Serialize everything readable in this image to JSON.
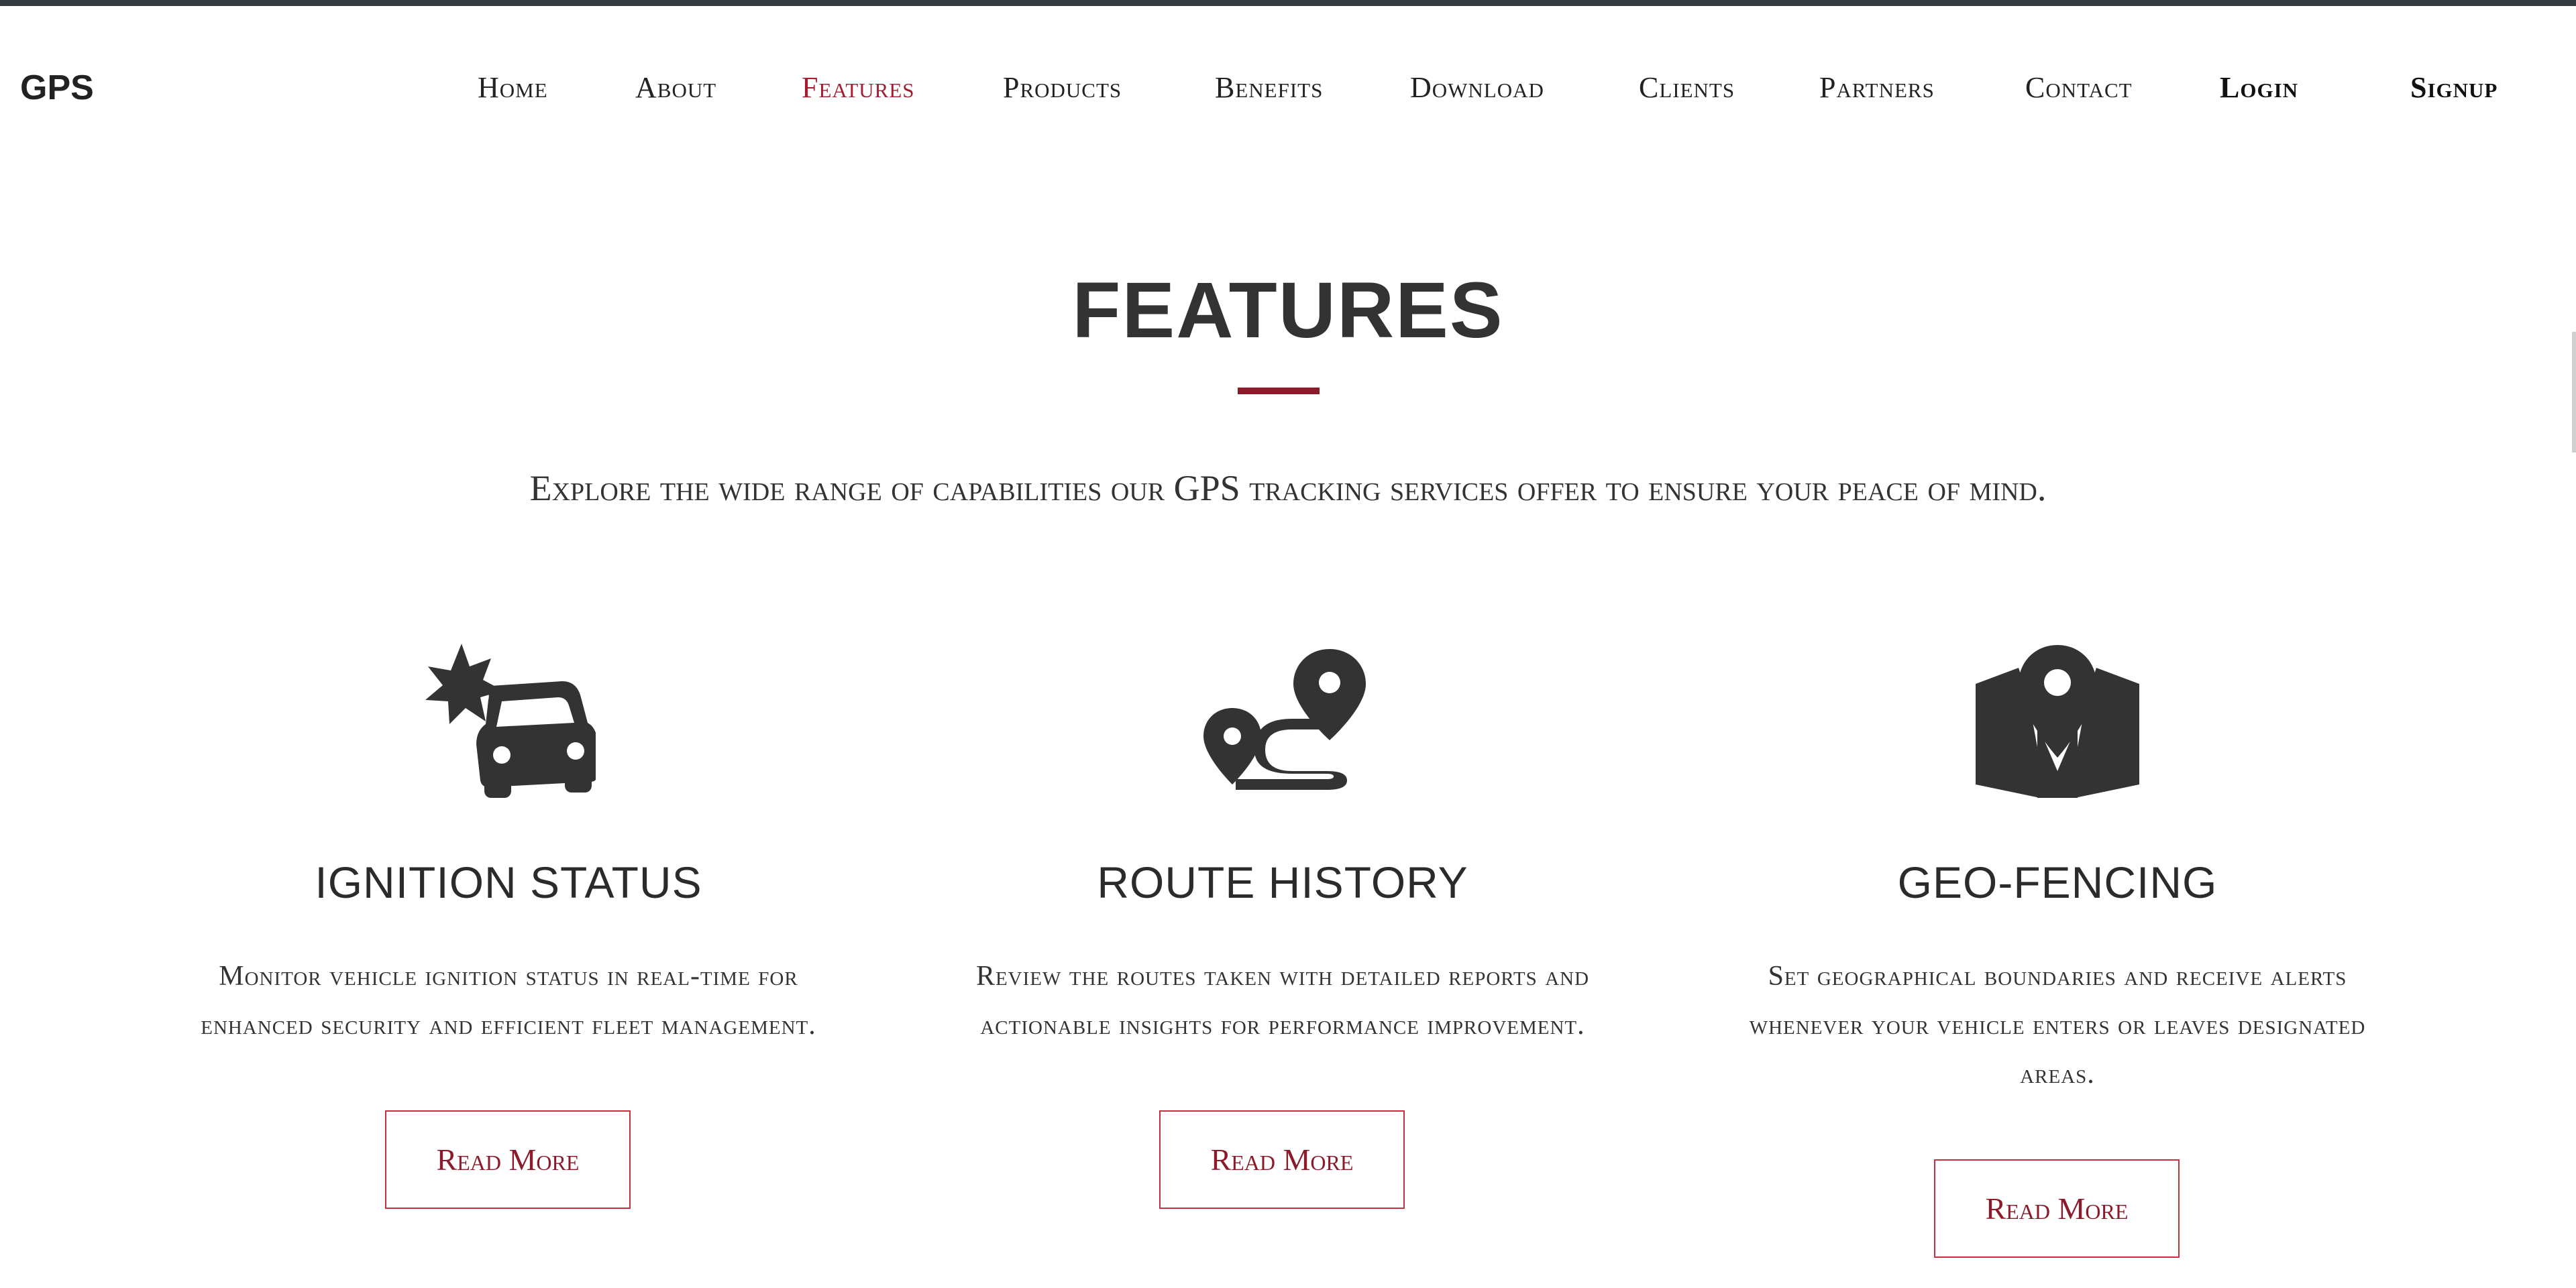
{
  "brand": "GPS",
  "nav": {
    "home": "Home",
    "about": "About",
    "features": "Features",
    "products": "Products",
    "benefits": "Benefits",
    "download": "Download",
    "clients": "Clients",
    "partners": "Partners",
    "contact": "Contact",
    "login": "Login",
    "signup": "Signup"
  },
  "section": {
    "title": "FEATURES",
    "subtitle": "Explore the wide range of capabilities our GPS tracking services offer to ensure your peace of mind."
  },
  "features": [
    {
      "icon": "car-crash-icon",
      "title": "IGNITION STATUS",
      "desc_line1": "Monitor vehicle ignition status in real-time for",
      "desc_line2": "enhanced security and efficient fleet management.",
      "button": "Read More"
    },
    {
      "icon": "route-icon",
      "title": "ROUTE HISTORY",
      "desc_line1": "Review the routes taken with detailed reports and",
      "desc_line2": "actionable insights for performance improvement.",
      "button": "Read More"
    },
    {
      "icon": "map-location-icon",
      "title": "GEO-FENCING",
      "desc_line1": "Set geographical boundaries and receive alerts",
      "desc_line2": "whenever your vehicle enters or leaves designated",
      "desc_line3": "areas.",
      "button": "Read More"
    }
  ],
  "colors": {
    "accent": "#a51c30",
    "underline": "#8b1b2a",
    "text": "#333333",
    "topbar": "#343a40"
  }
}
